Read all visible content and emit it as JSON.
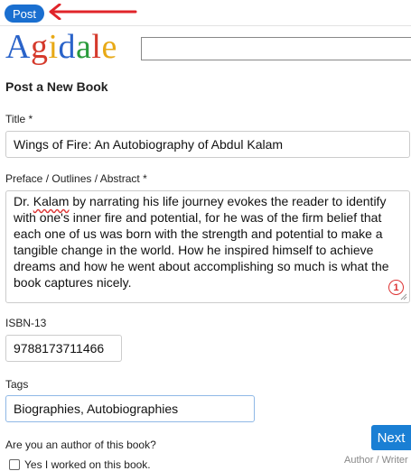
{
  "header": {
    "post_button_label": "Post",
    "logo": [
      "A",
      "g",
      "i",
      "d",
      "a",
      "l",
      "e"
    ],
    "search_value": ""
  },
  "form": {
    "heading": "Post a New Book",
    "title": {
      "label": "Title *",
      "value": "Wings of Fire: An Autobiography of Abdul Kalam"
    },
    "preface": {
      "label": "Preface / Outlines / Abstract *",
      "value_prefix": "Dr. ",
      "value_misspelled": "Kalam",
      "value_rest": " by narrating his life journey evokes the reader to identify with one's inner fire and potential, for he was of the firm belief that each one of us was born with the strength and potential to make a tangible change in the world. How he inspired himself to achieve dreams and how he went about accomplishing so much is what the book captures nicely.",
      "spell_badge": "1"
    },
    "isbn": {
      "label": "ISBN-13",
      "value": "9788173711466"
    },
    "tags": {
      "label": "Tags",
      "value": "Biographies, Autobiographies"
    },
    "author_question": "Are you an author of this book?",
    "author_checkbox_label": "Yes I worked on this book.",
    "role_hint": "Author / Writer",
    "next_button_label": "Next"
  },
  "colors": {
    "primary_button": "#1a6fd0",
    "annotation_arrow": "#e0242a",
    "spell_error": "#d33333"
  }
}
